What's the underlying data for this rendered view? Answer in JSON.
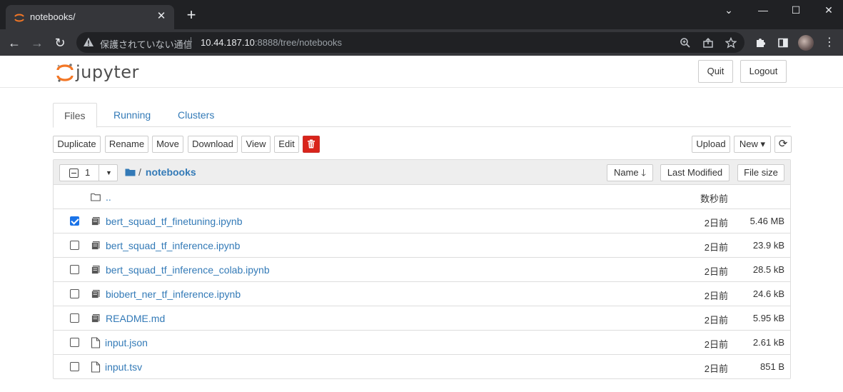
{
  "browser": {
    "tab_title": "notebooks/",
    "tab_close": "✕",
    "new_tab": "+",
    "window": {
      "minimize": "⌄",
      "min": "—",
      "max": "☐",
      "close": "✕"
    },
    "nav": {
      "back": "←",
      "forward": "→",
      "reload": "↻"
    },
    "security_text": "保護されていない通信",
    "url_host": "10.44.187.10",
    "url_rest": ":8888/tree/notebooks"
  },
  "header": {
    "logo_text": "jupyter",
    "quit_label": "Quit",
    "logout_label": "Logout"
  },
  "tabs": [
    {
      "label": "Files",
      "active": true
    },
    {
      "label": "Running",
      "active": false
    },
    {
      "label": "Clusters",
      "active": false
    }
  ],
  "actions": {
    "duplicate": "Duplicate",
    "rename": "Rename",
    "move": "Move",
    "download": "Download",
    "view": "View",
    "edit": "Edit",
    "upload": "Upload",
    "new": "New ▾",
    "refresh": "⟳"
  },
  "list_header": {
    "selected_count": "1",
    "caret": "▼",
    "crumb_sep": "/",
    "current_dir": "notebooks",
    "sort_name": "Name 🡓",
    "sort_modified": "Last Modified",
    "sort_size": "File size"
  },
  "files": [
    {
      "name": "..",
      "type": "folder",
      "modified": "数秒前",
      "size": "",
      "checked": false
    },
    {
      "name": "bert_squad_tf_finetuning.ipynb",
      "type": "notebook",
      "modified": "2日前",
      "size": "5.46 MB",
      "checked": true
    },
    {
      "name": "bert_squad_tf_inference.ipynb",
      "type": "notebook",
      "modified": "2日前",
      "size": "23.9 kB",
      "checked": false
    },
    {
      "name": "bert_squad_tf_inference_colab.ipynb",
      "type": "notebook",
      "modified": "2日前",
      "size": "28.5 kB",
      "checked": false
    },
    {
      "name": "biobert_ner_tf_inference.ipynb",
      "type": "notebook",
      "modified": "2日前",
      "size": "24.6 kB",
      "checked": false
    },
    {
      "name": "README.md",
      "type": "notebook",
      "modified": "2日前",
      "size": "5.95 kB",
      "checked": false
    },
    {
      "name": "input.json",
      "type": "file",
      "modified": "2日前",
      "size": "2.61 kB",
      "checked": false
    },
    {
      "name": "input.tsv",
      "type": "file",
      "modified": "2日前",
      "size": "851 B",
      "checked": false
    }
  ],
  "colors": {
    "link": "#337ab7",
    "delete": "#d9241b",
    "jupyter_orange": "#f37726"
  }
}
